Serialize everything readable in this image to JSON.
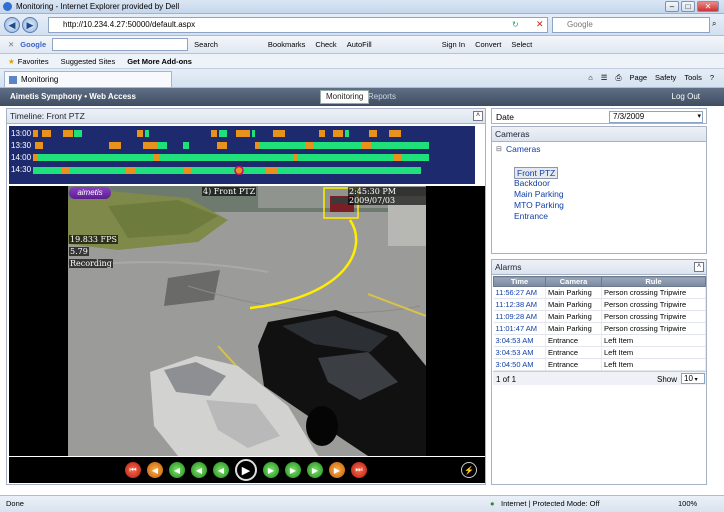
{
  "window": {
    "title": "Monitoring - Internet Explorer provided by Dell"
  },
  "address": {
    "url": "http://10.234.4.27:50000/default.aspx",
    "search_placeholder": "Google"
  },
  "google_bar": {
    "logo": "Google",
    "items": [
      "Search",
      "Bookmarks",
      "Check",
      "AutoFill",
      "Sign In",
      "Convert",
      "Select"
    ]
  },
  "favorites_bar": {
    "favorites": "Favorites",
    "suggested": "Suggested Sites",
    "addons": "Get More Add-ons"
  },
  "browser_tab": {
    "label": "Monitoring"
  },
  "command_bar": {
    "page": "Page",
    "safety": "Safety",
    "tools": "Tools"
  },
  "app": {
    "brand": "Aimetis Symphony • Web Access",
    "tab_monitoring": "Monitoring",
    "tab_reports": "Reports",
    "logout": "Log Out"
  },
  "timeline": {
    "title": "Timeline: Front PTZ",
    "rows": [
      {
        "label": "13:00"
      },
      {
        "label": "13:30"
      },
      {
        "label": "14:00"
      },
      {
        "label": "14:30"
      }
    ]
  },
  "video": {
    "logo": "aimetis",
    "camera_label": "4) Front PTZ",
    "timestamp": "2:45:30 PM 2009/07/03",
    "fps": "19.833 FPS",
    "value": "5.79",
    "status": "Recording"
  },
  "date_panel": {
    "label": "Date",
    "value": "7/3/2009"
  },
  "cameras_panel": {
    "title": "Cameras",
    "root": "Cameras",
    "items": [
      "Front PTZ",
      "Backdoor",
      "Main Parking",
      "MTO Parking",
      "Entrance"
    ],
    "selected": "Front PTZ"
  },
  "alarms_panel": {
    "title": "Alarms",
    "columns": [
      "Time",
      "Camera",
      "Rule"
    ],
    "rows": [
      [
        "11:56:27 AM",
        "Main Parking",
        "Person crossing Tripwire"
      ],
      [
        "11:12:38 AM",
        "Main Parking",
        "Person crossing Tripwire"
      ],
      [
        "11:09:28 AM",
        "Main Parking",
        "Person crossing Tripwire"
      ],
      [
        "11:01:47 AM",
        "Main Parking",
        "Person crossing Tripwire"
      ],
      [
        "3:04:53 AM",
        "Entrance",
        "Left Item"
      ],
      [
        "3:04:53 AM",
        "Entrance",
        "Left Item"
      ],
      [
        "3:04:50 AM",
        "Entrance",
        "Left Item"
      ]
    ],
    "pager": "1 of 1",
    "show_label": "Show",
    "show_value": "10"
  },
  "status_bar": {
    "left": "Done",
    "zone": "Internet | Protected Mode: Off",
    "zoom": "100%"
  },
  "colors": {
    "timeline_bg": "#1d2a6e",
    "motion_green": "#1fe07a",
    "event_orange": "#e8921e",
    "app_bar": "#4a586c",
    "link_blue": "#0f3ea6"
  }
}
